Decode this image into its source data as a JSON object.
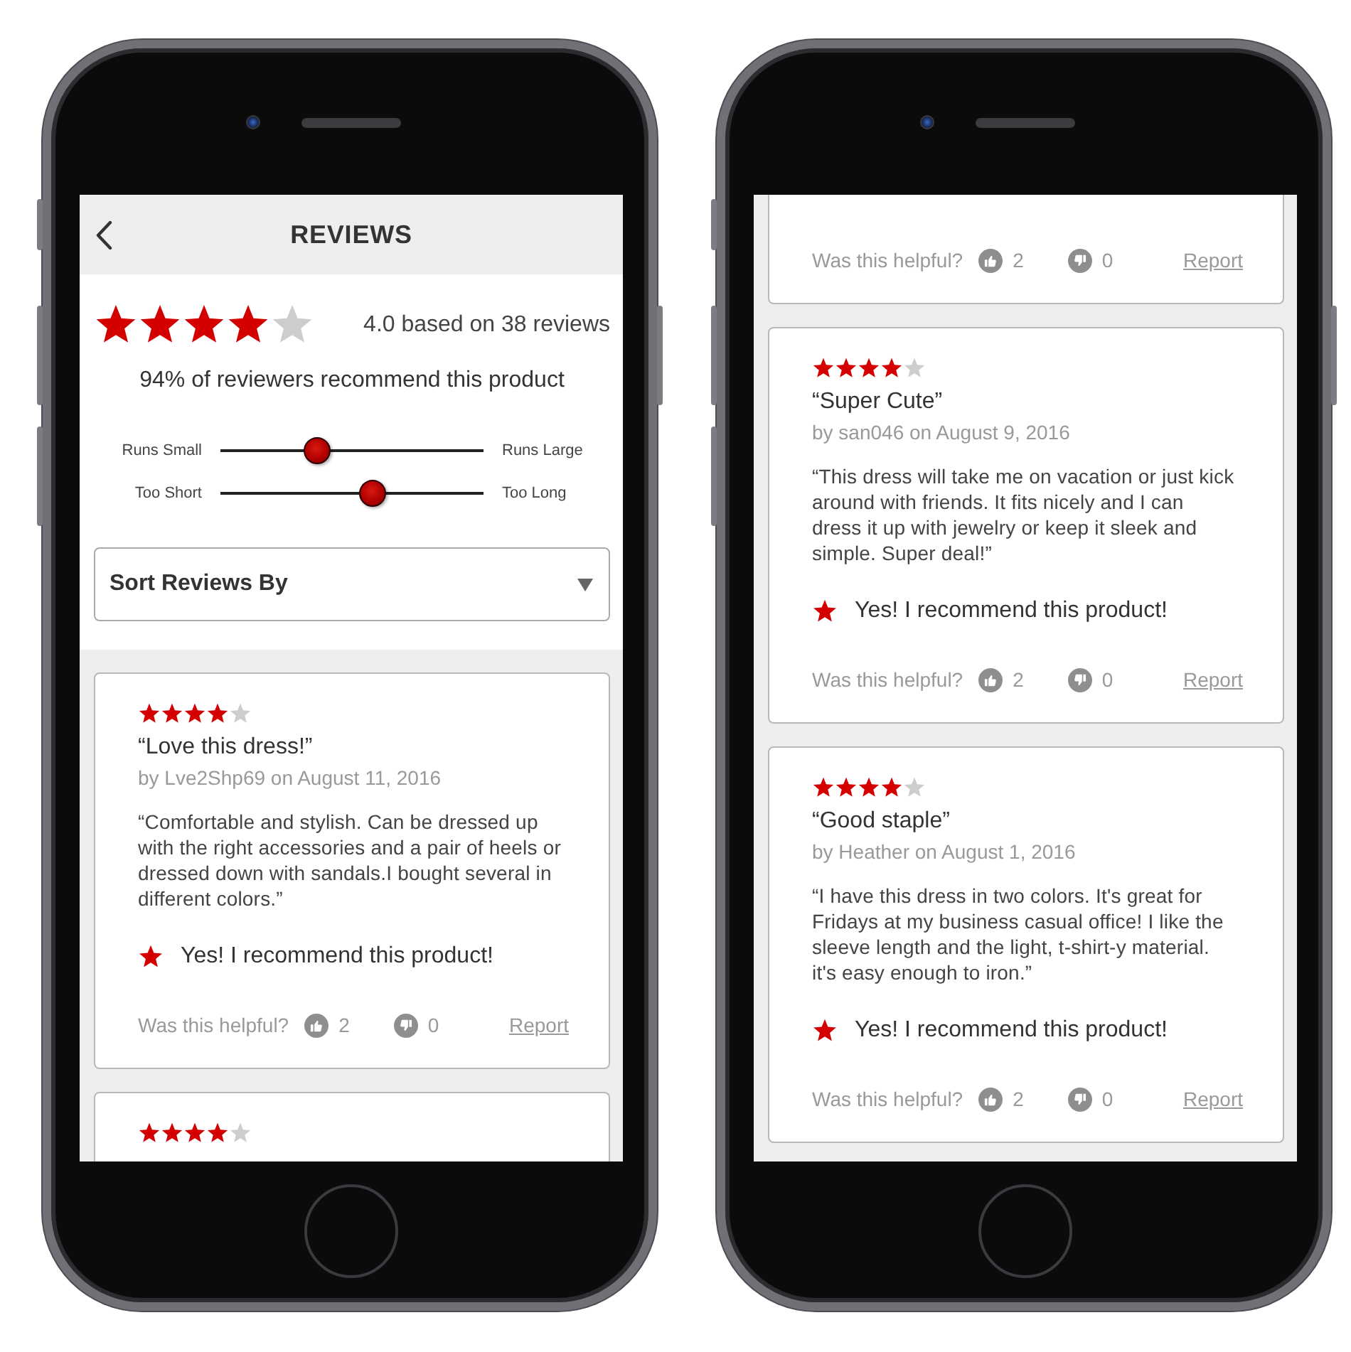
{
  "phones": [
    {
      "screen": {
        "header": {
          "title": "REVIEWS"
        },
        "summary": {
          "stars": 4,
          "rating_text": "4.0 based on 38 reviews",
          "recommend_text": "94% of reviewers recommend this product",
          "fit_sliders": [
            {
              "min_label": "Runs Small",
              "max_label": "Runs Large",
              "level": 0.37
            },
            {
              "min_label": "Too Short",
              "max_label": "Too Long",
              "level": 0.58
            }
          ],
          "sort_dropdown": {
            "label": "Sort Reviews By"
          }
        },
        "reviews": [
          {
            "kind": "full",
            "stars": 4,
            "title": "“Love this dress!”",
            "byline": "by Lve2Shp69 on August 11, 2016",
            "text": "“Comfortable and stylish. Can be dressed up\nwith the right accessories and a pair of heels or\ndressed down with sandals.I bought several in\ndifferent colors.”",
            "recommendation": "Yes! I recommend this product!",
            "helpful": {
              "label": "Was this helpful?",
              "up_count": "2",
              "down_count": "0"
            },
            "report": "Report"
          },
          {
            "kind": "clipped_bottom",
            "stars": 4
          }
        ]
      }
    },
    {
      "screen": {
        "reviews": [
          {
            "kind": "clipped_top",
            "helpful": {
              "label": "Was this helpful?",
              "up_count": "2",
              "down_count": "0"
            },
            "report": "Report"
          },
          {
            "kind": "full",
            "stars": 4,
            "title": "“Super Cute”",
            "byline": "by san046 on August 9, 2016",
            "text": "“This dress will take me on vacation or just kick\naround with friends. It fits nicely and I can\ndress it up with jewelry or keep it sleek and\nsimple. Super deal!”",
            "recommendation": "Yes! I recommend this product!",
            "helpful": {
              "label": "Was this helpful?",
              "up_count": "2",
              "down_count": "0"
            },
            "report": "Report"
          },
          {
            "kind": "full",
            "stars": 4,
            "title": "“Good staple”",
            "byline": "by Heather on August 1, 2016",
            "text": "“I have this dress in two colors. It's great for\nFridays at my business casual office! I like the\nsleeve length and the light, t-shirt-y material.\nit's easy enough to iron.”",
            "recommendation": "Yes! I recommend this product!",
            "helpful": {
              "label": "Was this helpful?",
              "up_count": "2",
              "down_count": "0"
            },
            "report": "Report"
          }
        ]
      }
    }
  ]
}
